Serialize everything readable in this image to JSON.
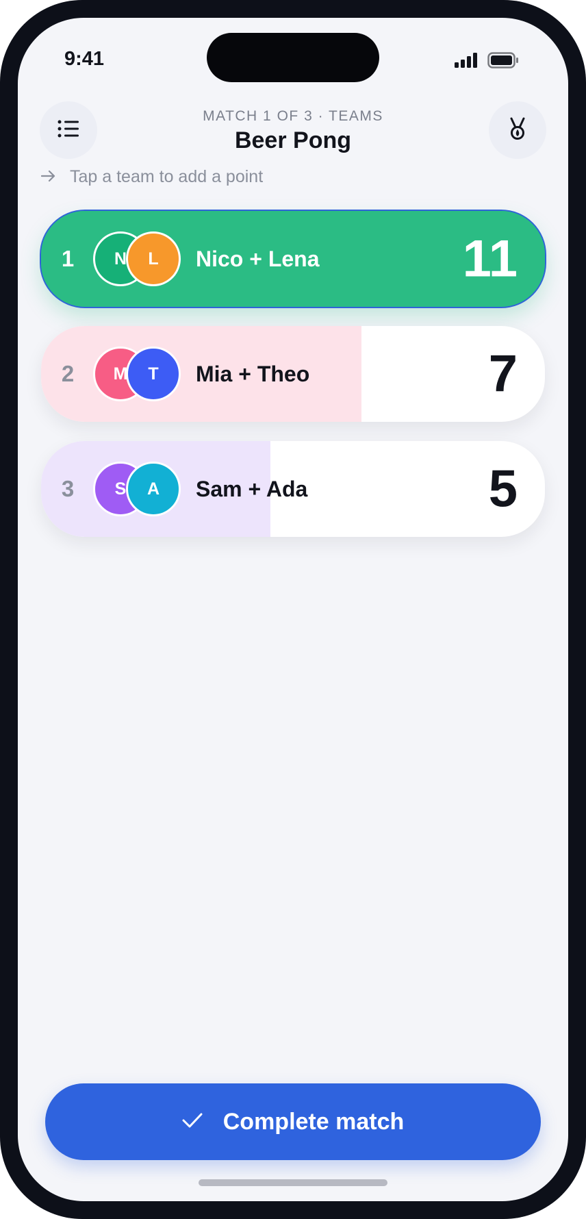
{
  "status_bar": {
    "time": "9:41",
    "icons": [
      "signal-icon",
      "battery-icon"
    ]
  },
  "header": {
    "subtitle": "MATCH 1 OF 3 · TEAMS",
    "title": "Beer Pong",
    "menu_icon": "list-icon",
    "right_icon": "medal-icon"
  },
  "hint": {
    "icon": "arrow-right-icon",
    "text": "Tap a team to add a point"
  },
  "teams": [
    {
      "rank": "1",
      "name": "Nico + Lena",
      "score": "11",
      "score_value": 11,
      "leader": true,
      "fill_color": "#2bbc84",
      "players": [
        {
          "initial": "N",
          "color": "#16b077"
        },
        {
          "initial": "L",
          "color": "#f7982b"
        }
      ]
    },
    {
      "rank": "2",
      "name": "Mia + Theo",
      "score": "7",
      "score_value": 7,
      "leader": false,
      "fill_color": "#fde2e9",
      "players": [
        {
          "initial": "M",
          "color": "#f75d85"
        },
        {
          "initial": "T",
          "color": "#3d5cf5"
        }
      ]
    },
    {
      "rank": "3",
      "name": "Sam + Ada",
      "score": "5",
      "score_value": 5,
      "leader": false,
      "fill_color": "#ede4fc",
      "players": [
        {
          "initial": "S",
          "color": "#9f5cf4"
        },
        {
          "initial": "A",
          "color": "#12b0d4"
        }
      ]
    }
  ],
  "actions": {
    "complete_label": "Complete match",
    "complete_icon": "check-icon",
    "accent": "#2f63de"
  }
}
